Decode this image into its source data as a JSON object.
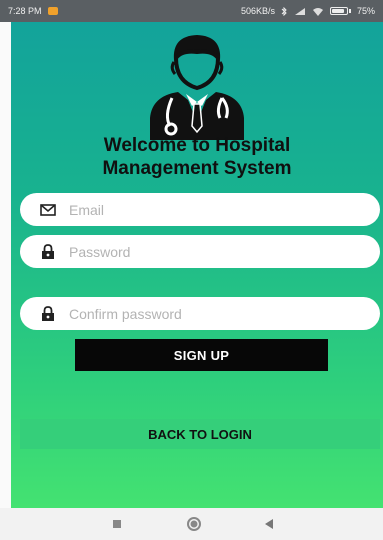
{
  "status_bar": {
    "time": "7:28 PM",
    "net_speed": "506KB/s",
    "battery": "75%"
  },
  "app": {
    "title_line1": "Welcome to Hospital",
    "title_line2": "Management System"
  },
  "form": {
    "email_placeholder": "Email",
    "password_placeholder": "Password",
    "confirm_placeholder": "Confirm password",
    "signup_label": "SIGN UP",
    "back_label": "BACK TO LOGIN"
  },
  "icons": {
    "avatar": "doctor-icon",
    "email": "mail-icon",
    "password": "lock-icon",
    "confirm": "lock-icon"
  },
  "colors": {
    "gradient_top": "#13a39b",
    "gradient_bottom": "#44e271",
    "button_dark": "#070707",
    "back_button": "#35cf7a"
  }
}
